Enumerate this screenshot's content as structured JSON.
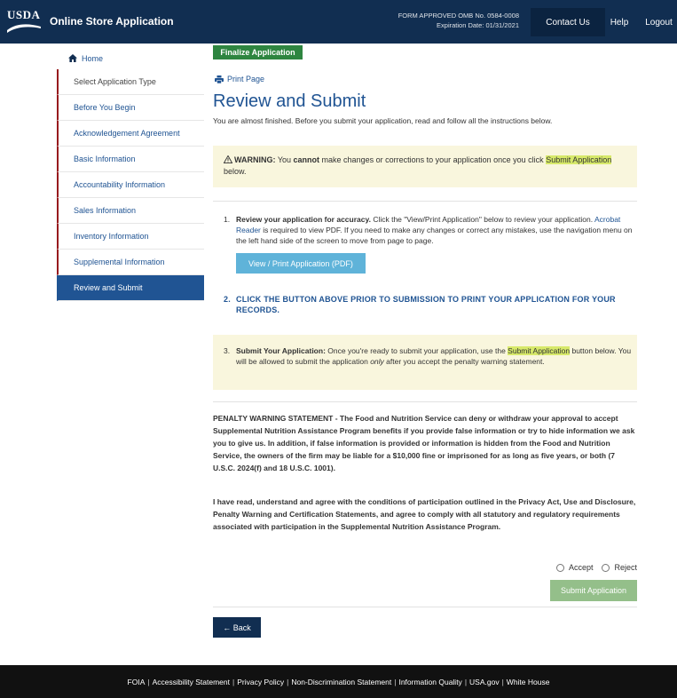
{
  "header": {
    "logo_text": "USDA",
    "app_title": "Online Store Application",
    "form_line1": "FORM APPROVED OMB No. 0584-0008",
    "form_line2": "Expiration Date: 01/31/2021",
    "contact_label": "Contact Us",
    "help_label": "Help",
    "logout_label": "Logout"
  },
  "sidebar": {
    "home_label": "Home",
    "items": [
      {
        "label": "Select Application Type"
      },
      {
        "label": "Before You Begin"
      },
      {
        "label": "Acknowledgement Agreement"
      },
      {
        "label": "Basic Information"
      },
      {
        "label": "Accountability Information"
      },
      {
        "label": "Sales Information"
      },
      {
        "label": "Inventory Information"
      },
      {
        "label": "Supplemental Information"
      },
      {
        "label": "Review and Submit"
      }
    ],
    "active_item": "Review and Submit"
  },
  "main": {
    "badge": "Finalize Application",
    "print_label": "Print Page",
    "title": "Review and Submit",
    "intro": "You are almost finished. Before you submit your application, read and follow all the instructions below.",
    "warning": {
      "prefix": "WARNING:",
      "text1": " You ",
      "emph": "cannot",
      "text2": " make changes or corrections to your application once you click ",
      "highlight": "Submit Application",
      "text3": " below."
    },
    "step1": {
      "num": "1.",
      "bold": "Review your application for accuracy.",
      "text1": " Click the \"View/Print Application\" below to review your application. ",
      "link": "Acrobat Reader",
      "text2": " is required to view PDF. If you need to make any changes or correct any mistakes, use the navigation menu on the left hand side of the screen to move from page to page.",
      "button": "View / Print Application (PDF)"
    },
    "step2": {
      "num": "2.",
      "text": "CLICK THE BUTTON ABOVE PRIOR TO SUBMISSION TO PRINT YOUR APPLICATION FOR YOUR RECORDS."
    },
    "step3": {
      "num": "3.",
      "bold": "Submit Your Application:",
      "text1": " Once you're ready to submit your application, use the ",
      "highlight": "Submit Application",
      "text2": " button below. You will be allowed to submit the application ",
      "emph": "only",
      "text3": " after you accept the penalty warning statement."
    },
    "penalty": "PENALTY WARNING STATEMENT - The Food and Nutrition Service can deny or withdraw your approval to accept Supplemental Nutrition Assistance Program benefits if you provide false information or try to hide information we ask you to give us. In addition, if false information is provided or information is hidden from the Food and Nutrition Service, the owners of the firm may be liable for a $10,000 fine or imprisoned for as long as five years, or both (7 U.S.C. 2024(f) and 18 U.S.C. 1001).",
    "certify": "I have read, understand and agree with the conditions of participation outlined in the Privacy Act, Use and Disclosure, Penalty Warning and Certification Statements, and agree to comply with all statutory and regulatory requirements associated with participation in the Supplemental Nutrition Assistance Program.",
    "accept_label": "Accept",
    "reject_label": "Reject",
    "submit_label": "Submit Application",
    "back_label": "← Back"
  },
  "footer": {
    "links": [
      "FOIA",
      "Accessibility Statement",
      "Privacy Policy",
      "Non-Discrimination Statement",
      "Information Quality",
      "USA.gov",
      "White House"
    ],
    "separator": "|"
  },
  "colors": {
    "header_bg": "#112e51",
    "accent_blue": "#205493",
    "finalize_green": "#2e8540",
    "warning_bg": "#f9f6dd",
    "highlight": "#d7e96a",
    "pdf_button": "#5fb3d9",
    "submit_disabled": "#94bf8a",
    "footer_bg": "#111111"
  }
}
